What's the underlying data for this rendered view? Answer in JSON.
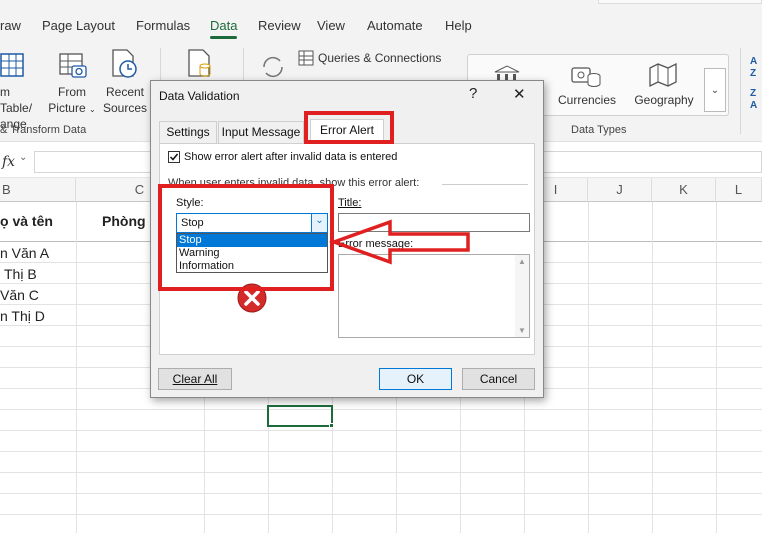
{
  "ribbon": {
    "tabs": [
      "raw",
      "Page Layout",
      "Formulas",
      "Data",
      "Review",
      "View",
      "Automate",
      "Help"
    ],
    "active_tab": "Data",
    "buttons": {
      "from_table": [
        "m Table/",
        "ange"
      ],
      "from_picture": [
        "From",
        "Picture"
      ],
      "recent_sources": [
        "Recent",
        "Sources"
      ],
      "queries_connections": "Queries & Connections",
      "currencies": "Currencies",
      "geography": "Geography"
    },
    "groups": {
      "get_transform": "& Transform Data",
      "data_types": "Data Types"
    }
  },
  "formula_bar": {
    "fx": "fx"
  },
  "sheet": {
    "columns": [
      "B",
      "C",
      "I",
      "J",
      "K",
      "L"
    ],
    "header_row": [
      "ọ và tên",
      "Phòng"
    ],
    "rows": [
      "n Văn A",
      "Thị B",
      "Văn C",
      "n Thị D"
    ]
  },
  "dialog": {
    "title": "Data Validation",
    "help": "?",
    "close": "✕",
    "tabs": [
      "Settings",
      "Input Message",
      "Error Alert"
    ],
    "active_tab": "Error Alert",
    "show_alert_label": "Show error alert after invalid data is entered",
    "show_alert_checked": true,
    "section_label": "When user enters invalid data, show this error alert:",
    "style_label": "Style:",
    "style_value": "Stop",
    "style_options": [
      "Stop",
      "Warning",
      "Information"
    ],
    "title_label": "Title:",
    "title_value": "",
    "error_message_label": "Error message:",
    "error_message_value": "",
    "clear_all": "Clear All",
    "ok": "OK",
    "cancel": "Cancel"
  },
  "colors": {
    "accent": "#1d6b3a",
    "highlight": "#e02020",
    "selection": "#0078d7",
    "stop_icon": "#d42a2a"
  }
}
